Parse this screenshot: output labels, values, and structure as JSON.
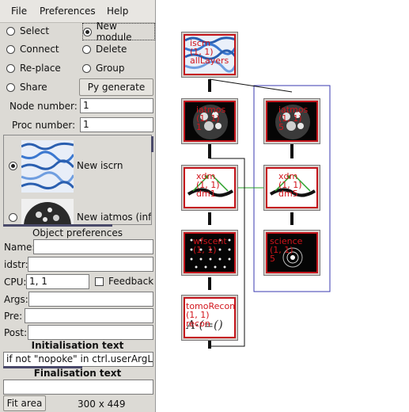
{
  "menubar": [
    "File",
    "Preferences",
    "Help"
  ],
  "modes": [
    {
      "label": "Select",
      "selected": false
    },
    {
      "label": "New module",
      "selected": true
    },
    {
      "label": "Connect",
      "selected": false
    },
    {
      "label": "Delete",
      "selected": false
    },
    {
      "label": "Re-place",
      "selected": false
    },
    {
      "label": "Group",
      "selected": false
    },
    {
      "label": "Share",
      "selected": false
    }
  ],
  "py_generate_label": "Py generate",
  "node_number": {
    "label": "Node number:",
    "value": "1"
  },
  "proc_number": {
    "label": "Proc number:",
    "value": "1"
  },
  "palette": [
    {
      "label": "New iscrn",
      "selected": true
    },
    {
      "label": "New iatmos (infin",
      "selected": false
    }
  ],
  "object_preferences": {
    "title": "Object preferences",
    "name_label": "Name:",
    "name_value": "",
    "idstr_label": "idstr:",
    "idstr_value": "",
    "cpu_label": "CPU:",
    "cpu_value": "1, 1",
    "feedback_label": "Feedback",
    "args_label": "Args:",
    "args_value": "",
    "pre_label": "Pre:",
    "pre_value": "",
    "post_label": "Post:",
    "post_value": ""
  },
  "init_text": {
    "title": "Initialisation text",
    "value": "if not \"nopoke\" in ctrl.userArgLis"
  },
  "final_text": {
    "title": "Finalisation text",
    "value": ""
  },
  "status": {
    "fit_area_label": "Fit area",
    "size_text": "300 x 449"
  },
  "nodes": [
    {
      "id": "iscrn",
      "lines": [
        "iscrn",
        "(1, 1)",
        "allLayers"
      ],
      "icon": "wave-pattern-icon"
    },
    {
      "id": "iatmos-1",
      "lines": [
        "iatmos",
        "(1, 1)",
        "1"
      ],
      "icon": "turbulence-blob-icon"
    },
    {
      "id": "iatmos-2",
      "lines": [
        "iatmos",
        "(1, 1)",
        "5"
      ],
      "icon": "turbulence-blob-icon"
    },
    {
      "id": "xdm-1",
      "lines": [
        "xdm",
        "(1, 1)",
        "dm1"
      ],
      "icon": "deformable-mirror-icon"
    },
    {
      "id": "xdm-2",
      "lines": [
        "xdm",
        "(1, 1)",
        "dm5"
      ],
      "icon": "deformable-mirror-icon"
    },
    {
      "id": "wfscent",
      "lines": [
        "wfscent",
        "(1, 1)",
        ""
      ],
      "icon": "spot-grid-icon"
    },
    {
      "id": "science",
      "lines": [
        "science",
        "(1, 1)",
        "5"
      ],
      "icon": "psf-icon"
    },
    {
      "id": "tomoRecon",
      "lines": [
        "tomoRecon",
        "(1, 1)",
        "recon"
      ],
      "icon": "equation-icon"
    }
  ]
}
